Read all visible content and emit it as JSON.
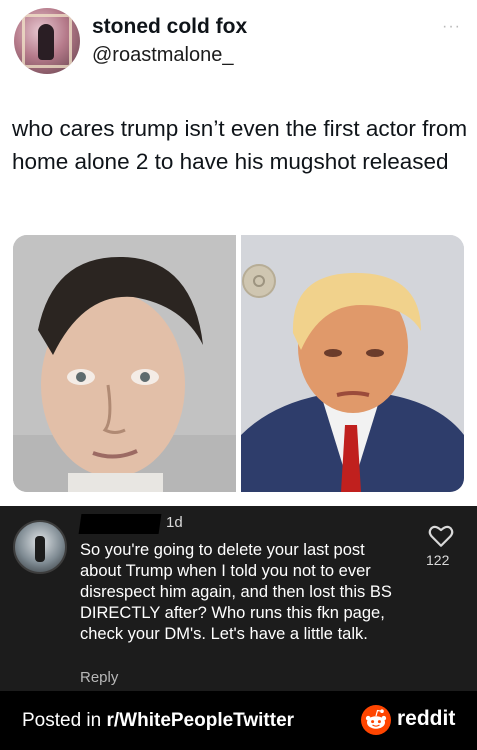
{
  "tweet": {
    "display_name": "stoned cold fox",
    "handle": "@roastmalone_",
    "more_label": "···",
    "text": "who cares trump isn’t even the first actor from home alone 2 to have his mugshot released",
    "photos": [
      {
        "name": "mugshot-left",
        "icon": "photo"
      },
      {
        "name": "mugshot-right",
        "icon": "photo"
      }
    ]
  },
  "comment": {
    "time": "1d",
    "body": "So you're going to delete your last post about Trump when I told you not to ever disrespect him again, and then lost this BS DIRECTLY after? Who runs this fkn page, check your DM's. Let's have a little talk.",
    "likes": "122",
    "reply_label": "Reply",
    "like_icon": "heart-icon"
  },
  "footer": {
    "posted_prefix": "Posted in ",
    "subreddit": "r/WhitePeopleTwitter",
    "brand": "reddit",
    "brand_color": "#ff4500"
  },
  "colors": {
    "comment_bg": "#1c1c1c",
    "footer_bg": "#000000",
    "text_dark": "#0f1419"
  }
}
